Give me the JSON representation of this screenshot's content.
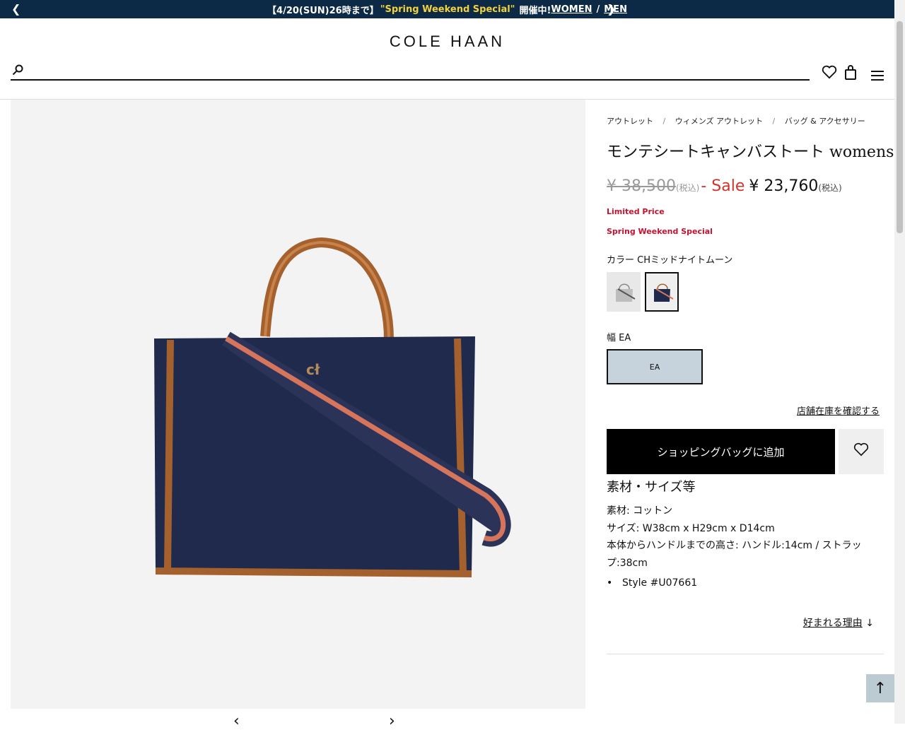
{
  "promo": {
    "prefix": "【4/20(SUN)26時まで】",
    "highlight": "\"Spring Weekend Special\"",
    "suffix": "開催中!",
    "women": "WOMEN",
    "sep": "/",
    "men": "MEN"
  },
  "header": {
    "logo": "COLE HAAN",
    "search_placeholder": ""
  },
  "breadcrumb": [
    "アウトレット",
    "ウィメンズ アウトレット",
    "バッグ & アクセサリー"
  ],
  "breadcrumb_sep": "/",
  "product": {
    "title": "モンテシートキャンバストート womens.",
    "old_price": "¥ 38,500",
    "tax_label": "(税込)",
    "sale_label": "- Sale",
    "sale_price": "¥ 23,760",
    "limited": "Limited Price",
    "special": "Spring Weekend Special",
    "color_label": "カラー CHミッドナイトムーン",
    "width_label": "幅 EA",
    "width_option": "EA",
    "stock_link": "店舗在庫を確認する",
    "add_to_bag": "ショッピングバッグに追加"
  },
  "materials": {
    "heading": "素材・サイズ等",
    "material": "素材: コットン",
    "size": "サイズ: W38cm x H29cm x D14cm",
    "height": "本体からハンドルまでの高さ: ハンドル:14cm / ストラップ:38cm",
    "style": "Style #U07661"
  },
  "reason_link": "好まれる理由",
  "colors": {
    "navy": "#1f2a4d",
    "tan": "#a4612e",
    "strap_orange": "#d7745c",
    "promo_bg": "#0c2a45",
    "sale_red": "#d0342c",
    "selected_width_bg": "#c6d3dc"
  }
}
